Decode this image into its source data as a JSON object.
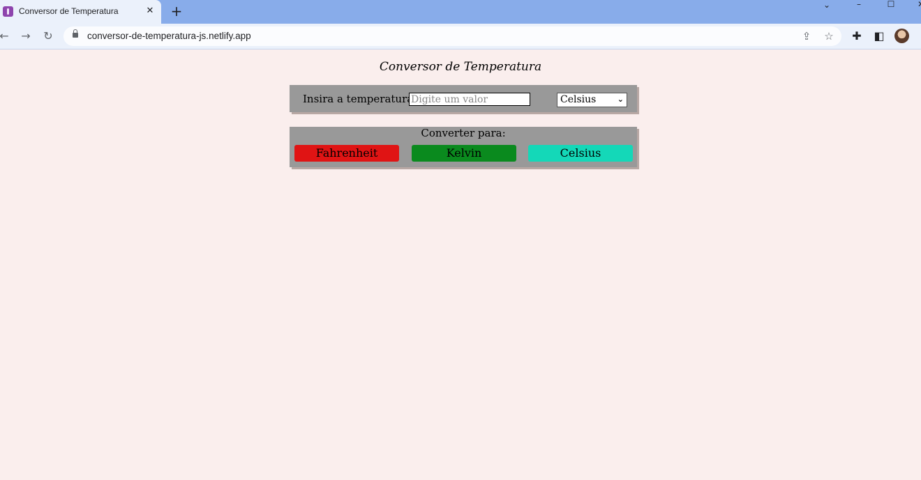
{
  "browser": {
    "tab_title": "Conversor de Temperatura",
    "url": "conversor-de-temperatura-js.netlify.app"
  },
  "page": {
    "title": "Conversor de Temperatura",
    "input_label": "Insira a temperatura:",
    "input_placeholder": "Digite um valor",
    "input_value": "",
    "unit_selected": "Celsius",
    "convert_label": "Converter para:",
    "buttons": [
      "Fahrenheit",
      "Kelvin",
      "Celsius"
    ]
  },
  "colors": {
    "background": "#faeeed",
    "panel": "#999999",
    "fahrenheit_button": "#e01414",
    "kelvin_button": "#0a8a1e",
    "celsius_button": "#14d8b8",
    "tab_strip": "#88acea"
  }
}
